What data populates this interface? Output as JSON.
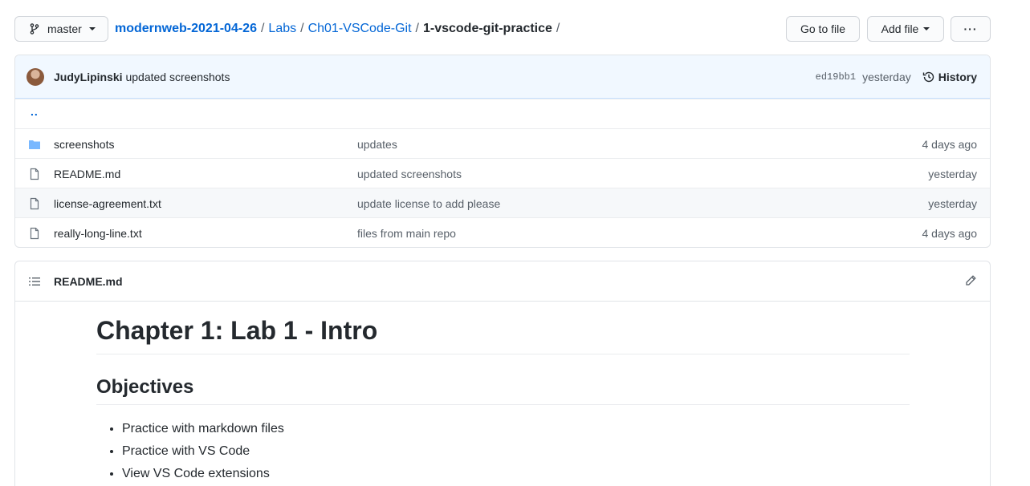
{
  "topbar": {
    "branch": "master",
    "breadcrumb": {
      "repo": "modernweb-2021-04-26",
      "part1": "Labs",
      "part2": "Ch01-VSCode-Git",
      "current": "1-vscode-git-practice",
      "separator": "/"
    },
    "go_to_file": "Go to file",
    "add_file": "Add file",
    "more": "···"
  },
  "commit": {
    "author": "JudyLipinski",
    "message": "updated screenshots",
    "sha": "ed19bb1",
    "time": "yesterday",
    "history": "History"
  },
  "files": {
    "updir": "..",
    "rows": [
      {
        "name": "screenshots",
        "type": "folder",
        "message": "updates",
        "age": "4 days ago"
      },
      {
        "name": "README.md",
        "type": "file",
        "message": "updated screenshots",
        "age": "yesterday"
      },
      {
        "name": "license-agreement.txt",
        "type": "file",
        "message": "update license to add please",
        "age": "yesterday"
      },
      {
        "name": "really-long-line.txt",
        "type": "file",
        "message": "files from main repo",
        "age": "4 days ago"
      }
    ]
  },
  "readme": {
    "filename": "README.md",
    "h1": "Chapter 1: Lab 1 - Intro",
    "h2": "Objectives",
    "bullets": [
      "Practice with markdown files",
      "Practice with VS Code",
      "View VS Code extensions"
    ]
  },
  "colors": {
    "link": "#0366d6",
    "commit_bar": "#f1f8ff",
    "folder": "#79b8ff"
  }
}
